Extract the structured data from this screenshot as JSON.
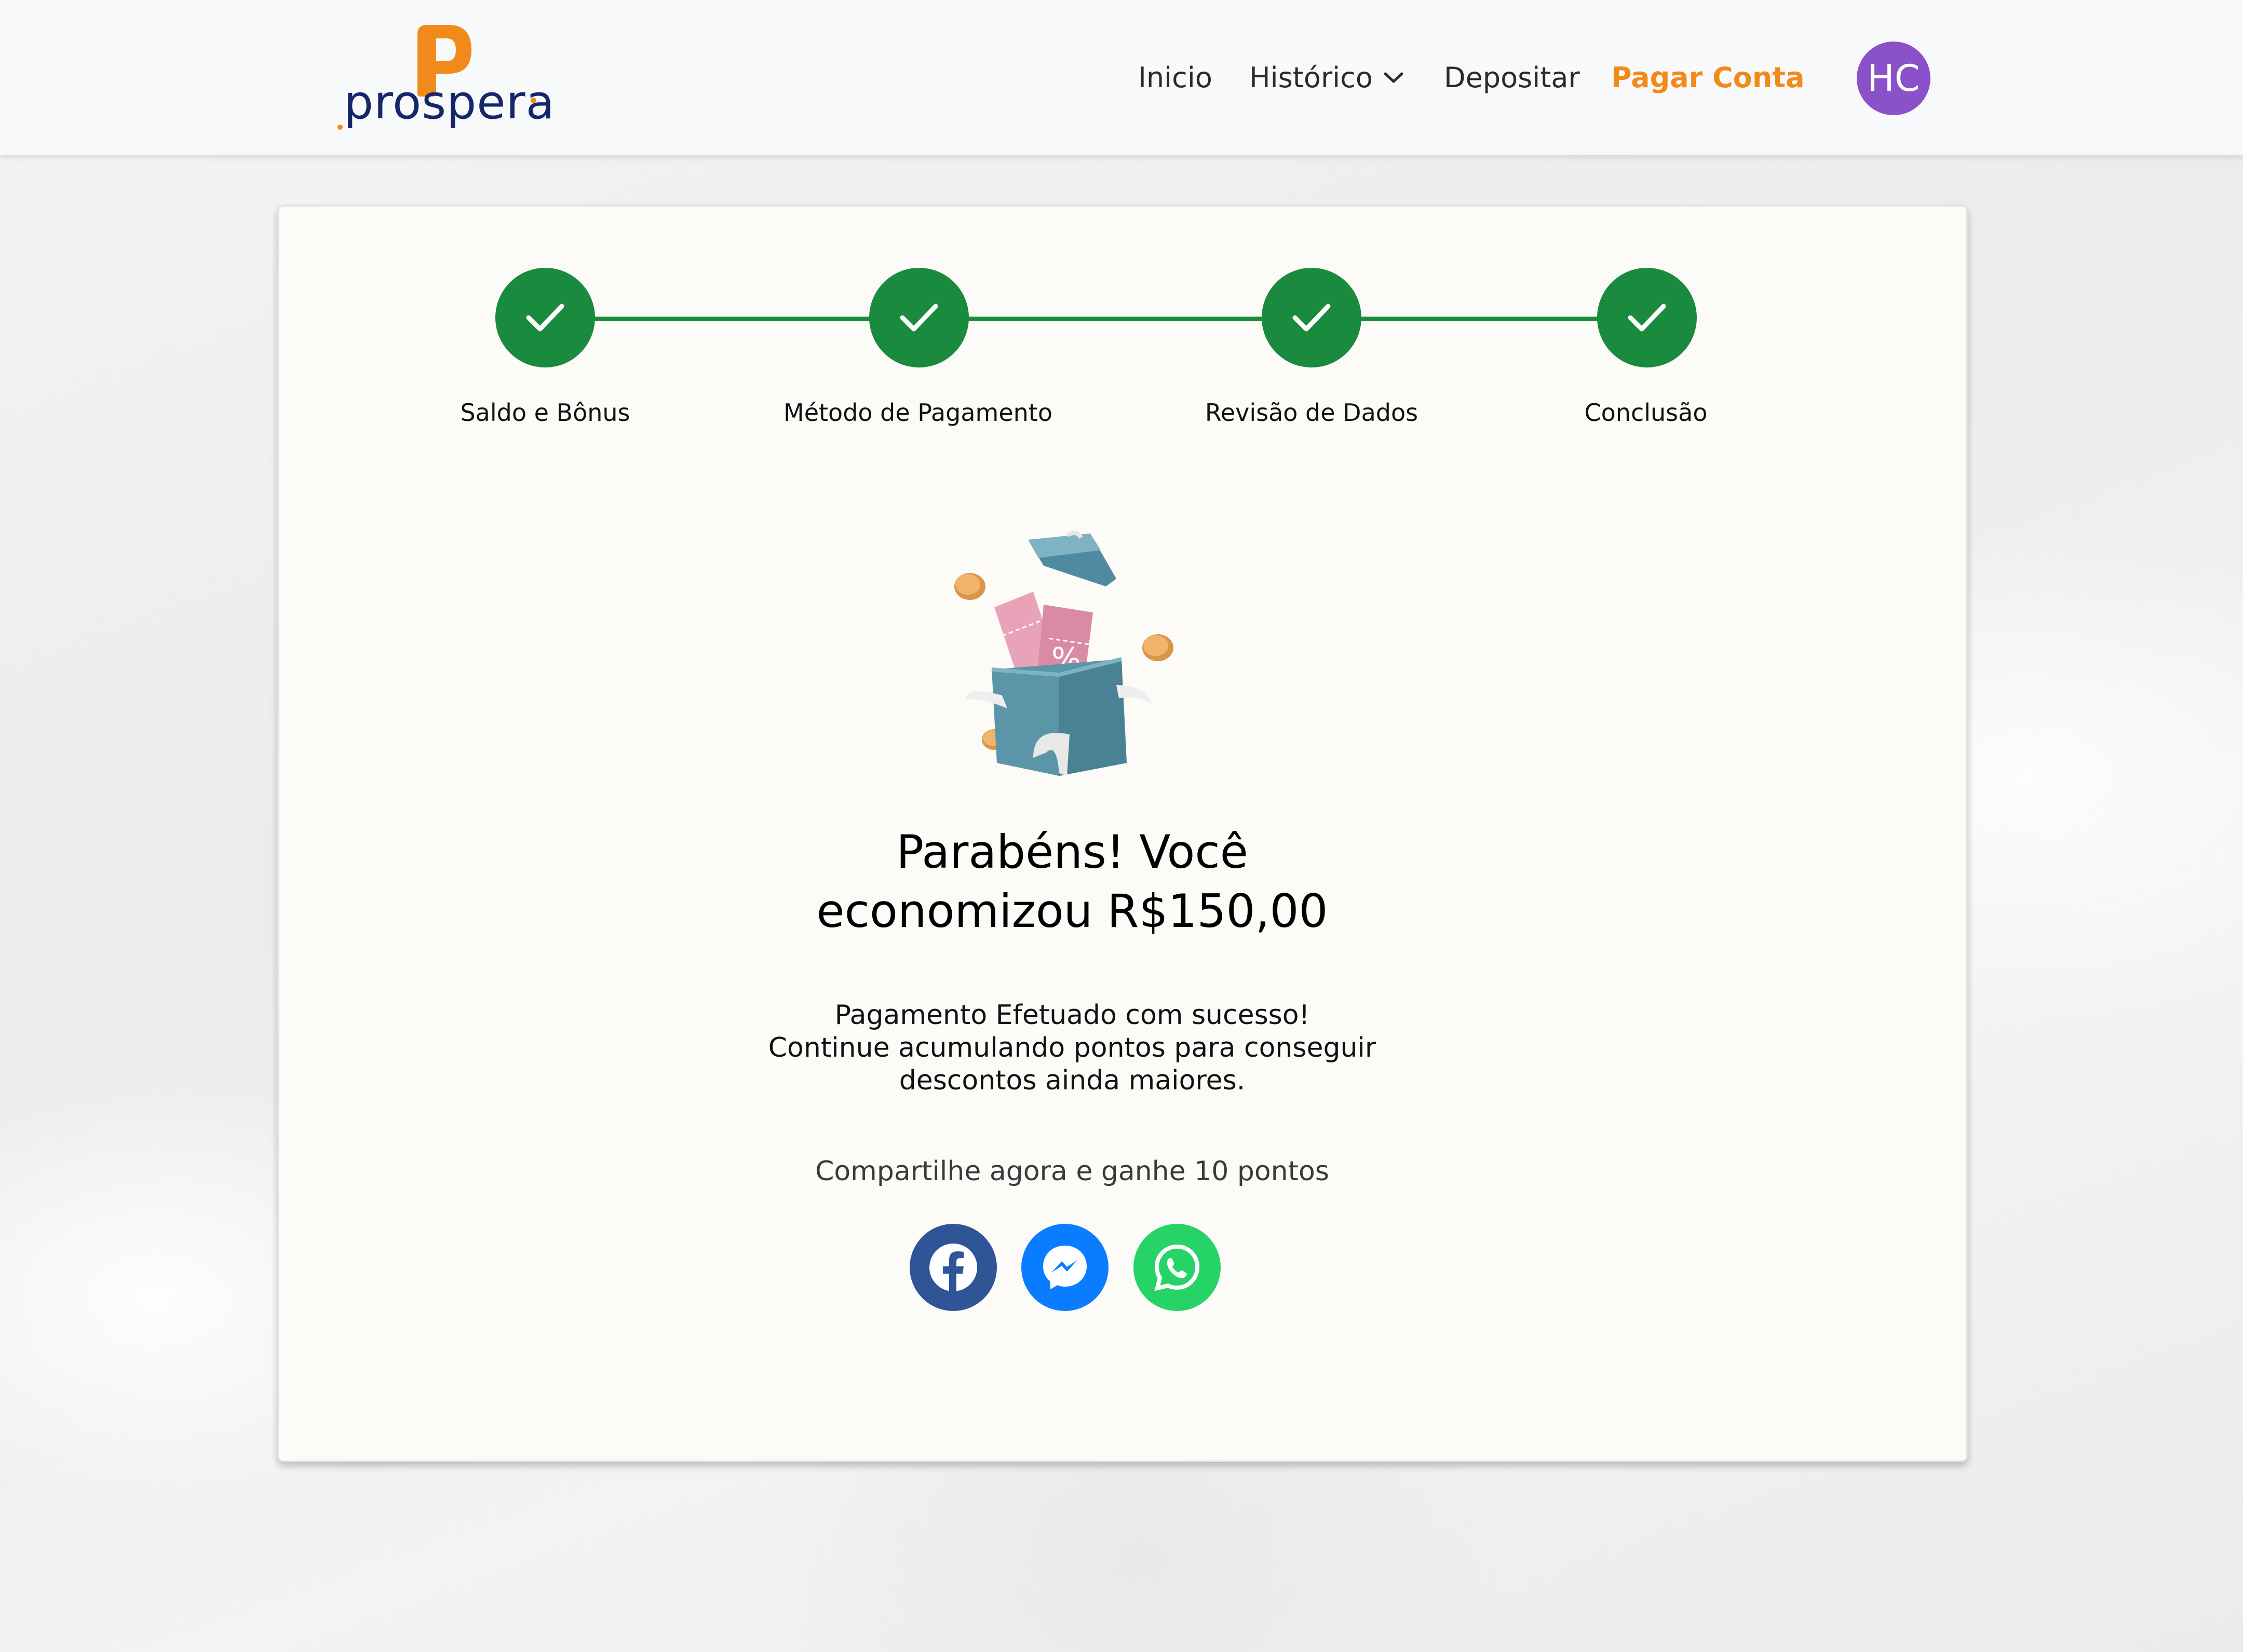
{
  "header": {
    "brand": "prospera",
    "nav": {
      "inicio": "Inicio",
      "historico": "Histórico",
      "depositar": "Depositar",
      "pagar_conta": "Pagar Conta"
    },
    "avatar_initials": "HC",
    "colors": {
      "accent": "#f28a1b",
      "brand_text": "#15266a",
      "avatar_bg": "#8a51c9"
    }
  },
  "stepper": {
    "steps": [
      {
        "label": "Saldo e Bônus",
        "status": "complete"
      },
      {
        "label": "Método de Pagamento",
        "status": "complete"
      },
      {
        "label": "Revisão de Dados",
        "status": "complete"
      },
      {
        "label": "Conclusão",
        "status": "complete"
      }
    ],
    "color": "#1a8a3f"
  },
  "result": {
    "illustration": "open-gift-box-with-coupons-icon",
    "headline_line1": "Parabéns! Você",
    "headline_line2": "economizou R$150,00",
    "message_line1": "Pagamento Efetuado com sucesso!",
    "message_line2": "Continue acumulando pontos para conseguir",
    "message_line3": "descontos ainda maiores.",
    "share_prompt": "Compartilhe agora e ganhe 10 pontos"
  },
  "share": {
    "facebook": {
      "icon": "facebook-icon",
      "color": "#2f5597"
    },
    "messenger": {
      "icon": "messenger-icon",
      "color": "#0a7cff"
    },
    "whatsapp": {
      "icon": "whatsapp-icon",
      "color": "#25d366"
    }
  }
}
